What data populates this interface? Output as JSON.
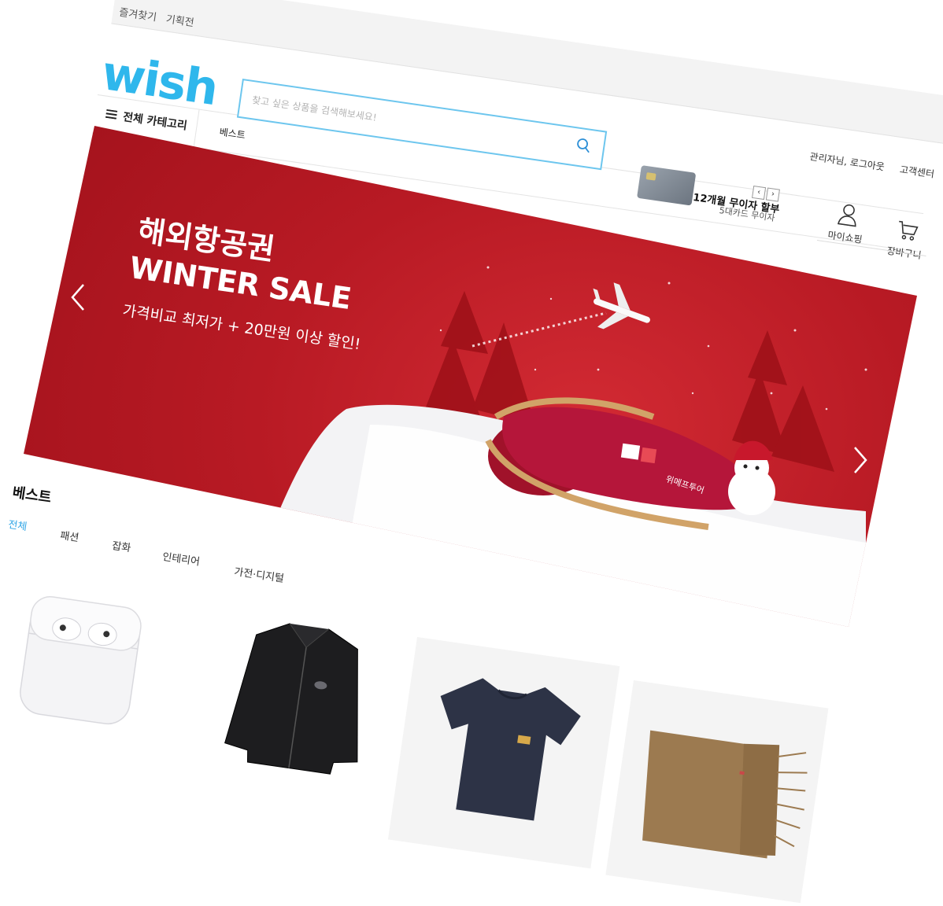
{
  "utility": {
    "bookmark": "즐겨찾기",
    "exhibition": "기획전"
  },
  "logo": {
    "text": "wish",
    "color": "#2fb7ec"
  },
  "search": {
    "placeholder": "찾고 싶은 상품을 검색해보세요!"
  },
  "category": {
    "all_label": "전체 카테고리",
    "best_label": "베스트"
  },
  "card_promo": {
    "title": "12개월 무이자 할부",
    "subtitle": "5대카드 무이자",
    "prev": "‹",
    "next": "›"
  },
  "user": {
    "status": "관리자님, 로그아웃",
    "support": "고객센터"
  },
  "header_buttons": {
    "my_shopping": "마이쇼핑",
    "cart": "장바구니"
  },
  "banner": {
    "line1": "해외항공권",
    "line2": "WINTER SALE",
    "line3": "가격비교 최저가 + 20만원 이상 할인!",
    "sled_text": "위메프투어",
    "primary_color": "#b81a24"
  },
  "best": {
    "title": "베스트",
    "tabs": [
      {
        "label": "전체",
        "active": true
      },
      {
        "label": "패션",
        "active": false
      },
      {
        "label": "잡화",
        "active": false
      },
      {
        "label": "인테리어",
        "active": false
      },
      {
        "label": "가전·디지털",
        "active": false
      }
    ],
    "active_color": "#31a6e6"
  },
  "products": [
    {
      "icon": "airpods-image"
    },
    {
      "icon": "black-jacket-image"
    },
    {
      "icon": "navy-tshirt-image"
    },
    {
      "icon": "brown-scarf-image"
    }
  ]
}
